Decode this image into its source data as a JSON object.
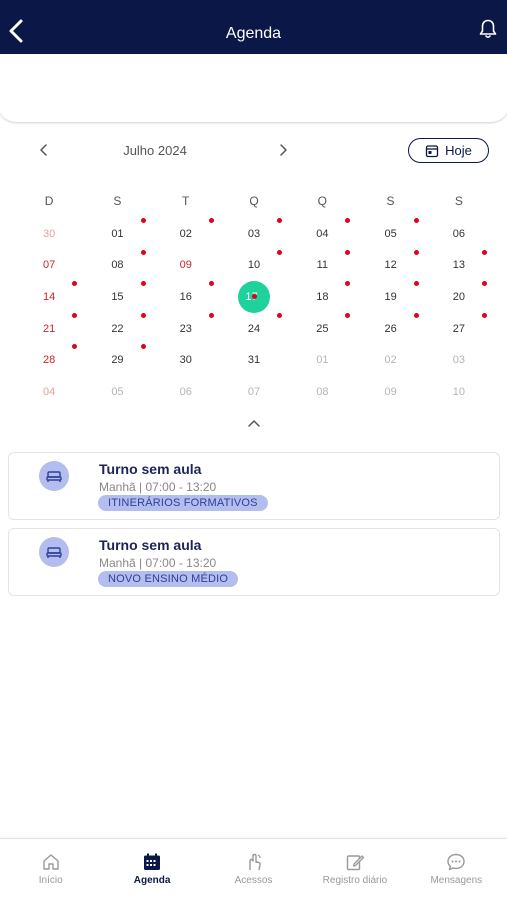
{
  "header": {
    "title": "Agenda"
  },
  "calendar": {
    "month_label": "Julho 2024",
    "today_label": "Hoje",
    "weekdays": [
      "D",
      "S",
      "T",
      "Q",
      "Q",
      "S",
      "S"
    ],
    "weeks": [
      [
        {
          "d": "30",
          "o": 1
        },
        {
          "d": "01",
          "dot": 1
        },
        {
          "d": "02",
          "dot": 1
        },
        {
          "d": "03",
          "dot": 1
        },
        {
          "d": "04",
          "dot": 1
        },
        {
          "d": "05",
          "dot": 1
        },
        {
          "d": "06"
        }
      ],
      [
        {
          "d": "07"
        },
        {
          "d": "08",
          "dot": 1
        },
        {
          "d": "09",
          "h": 1
        },
        {
          "d": "10",
          "dot": 1
        },
        {
          "d": "11",
          "dot": 1
        },
        {
          "d": "12",
          "dot": 1
        },
        {
          "d": "13",
          "dot": 1
        }
      ],
      [
        {
          "d": "14",
          "dot": 1
        },
        {
          "d": "15",
          "dot": 1
        },
        {
          "d": "16",
          "dot": 1
        },
        {
          "d": "17",
          "sel": 1,
          "dot": 1
        },
        {
          "d": "18",
          "dot": 1
        },
        {
          "d": "19",
          "dot": 1
        },
        {
          "d": "20",
          "dot": 1
        }
      ],
      [
        {
          "d": "21",
          "dot": 1
        },
        {
          "d": "22",
          "dot": 1
        },
        {
          "d": "23",
          "dot": 1
        },
        {
          "d": "24",
          "dot": 1
        },
        {
          "d": "25",
          "dot": 1
        },
        {
          "d": "26",
          "dot": 1
        },
        {
          "d": "27",
          "dot": 1
        }
      ],
      [
        {
          "d": "28",
          "dot": 1
        },
        {
          "d": "29",
          "dot": 1
        },
        {
          "d": "30"
        },
        {
          "d": "31"
        },
        {
          "d": "01",
          "o": 1
        },
        {
          "d": "02",
          "o": 1
        },
        {
          "d": "03",
          "o": 1
        }
      ],
      [
        {
          "d": "04",
          "o": 1
        },
        {
          "d": "05",
          "o": 1
        },
        {
          "d": "06",
          "o": 1
        },
        {
          "d": "07",
          "o": 1
        },
        {
          "d": "08",
          "o": 1
        },
        {
          "d": "09",
          "o": 1
        },
        {
          "d": "10",
          "o": 1
        }
      ]
    ]
  },
  "events": [
    {
      "title": "Turno sem aula",
      "time": "Manhã | 07:00 - 13:20",
      "tag": "ITINERÁRIOS FORMATIVOS"
    },
    {
      "title": "Turno sem aula",
      "time": "Manhã | 07:00 - 13:20",
      "tag": "NOVO ENSINO MÉDIO"
    }
  ],
  "nav": [
    {
      "label": "Início",
      "icon": "home-icon"
    },
    {
      "label": "Agenda",
      "icon": "calendar-icon",
      "active": true
    },
    {
      "label": "Acessos",
      "icon": "access-icon"
    },
    {
      "label": "Registro diário",
      "icon": "edit-icon"
    },
    {
      "label": "Mensagens",
      "icon": "message-icon"
    }
  ],
  "colors": {
    "navy": "#0b1747",
    "selected": "#1fd19a",
    "dot": "#e4001b",
    "tag_bg": "#b3bdee",
    "sunday": "#c62828"
  }
}
